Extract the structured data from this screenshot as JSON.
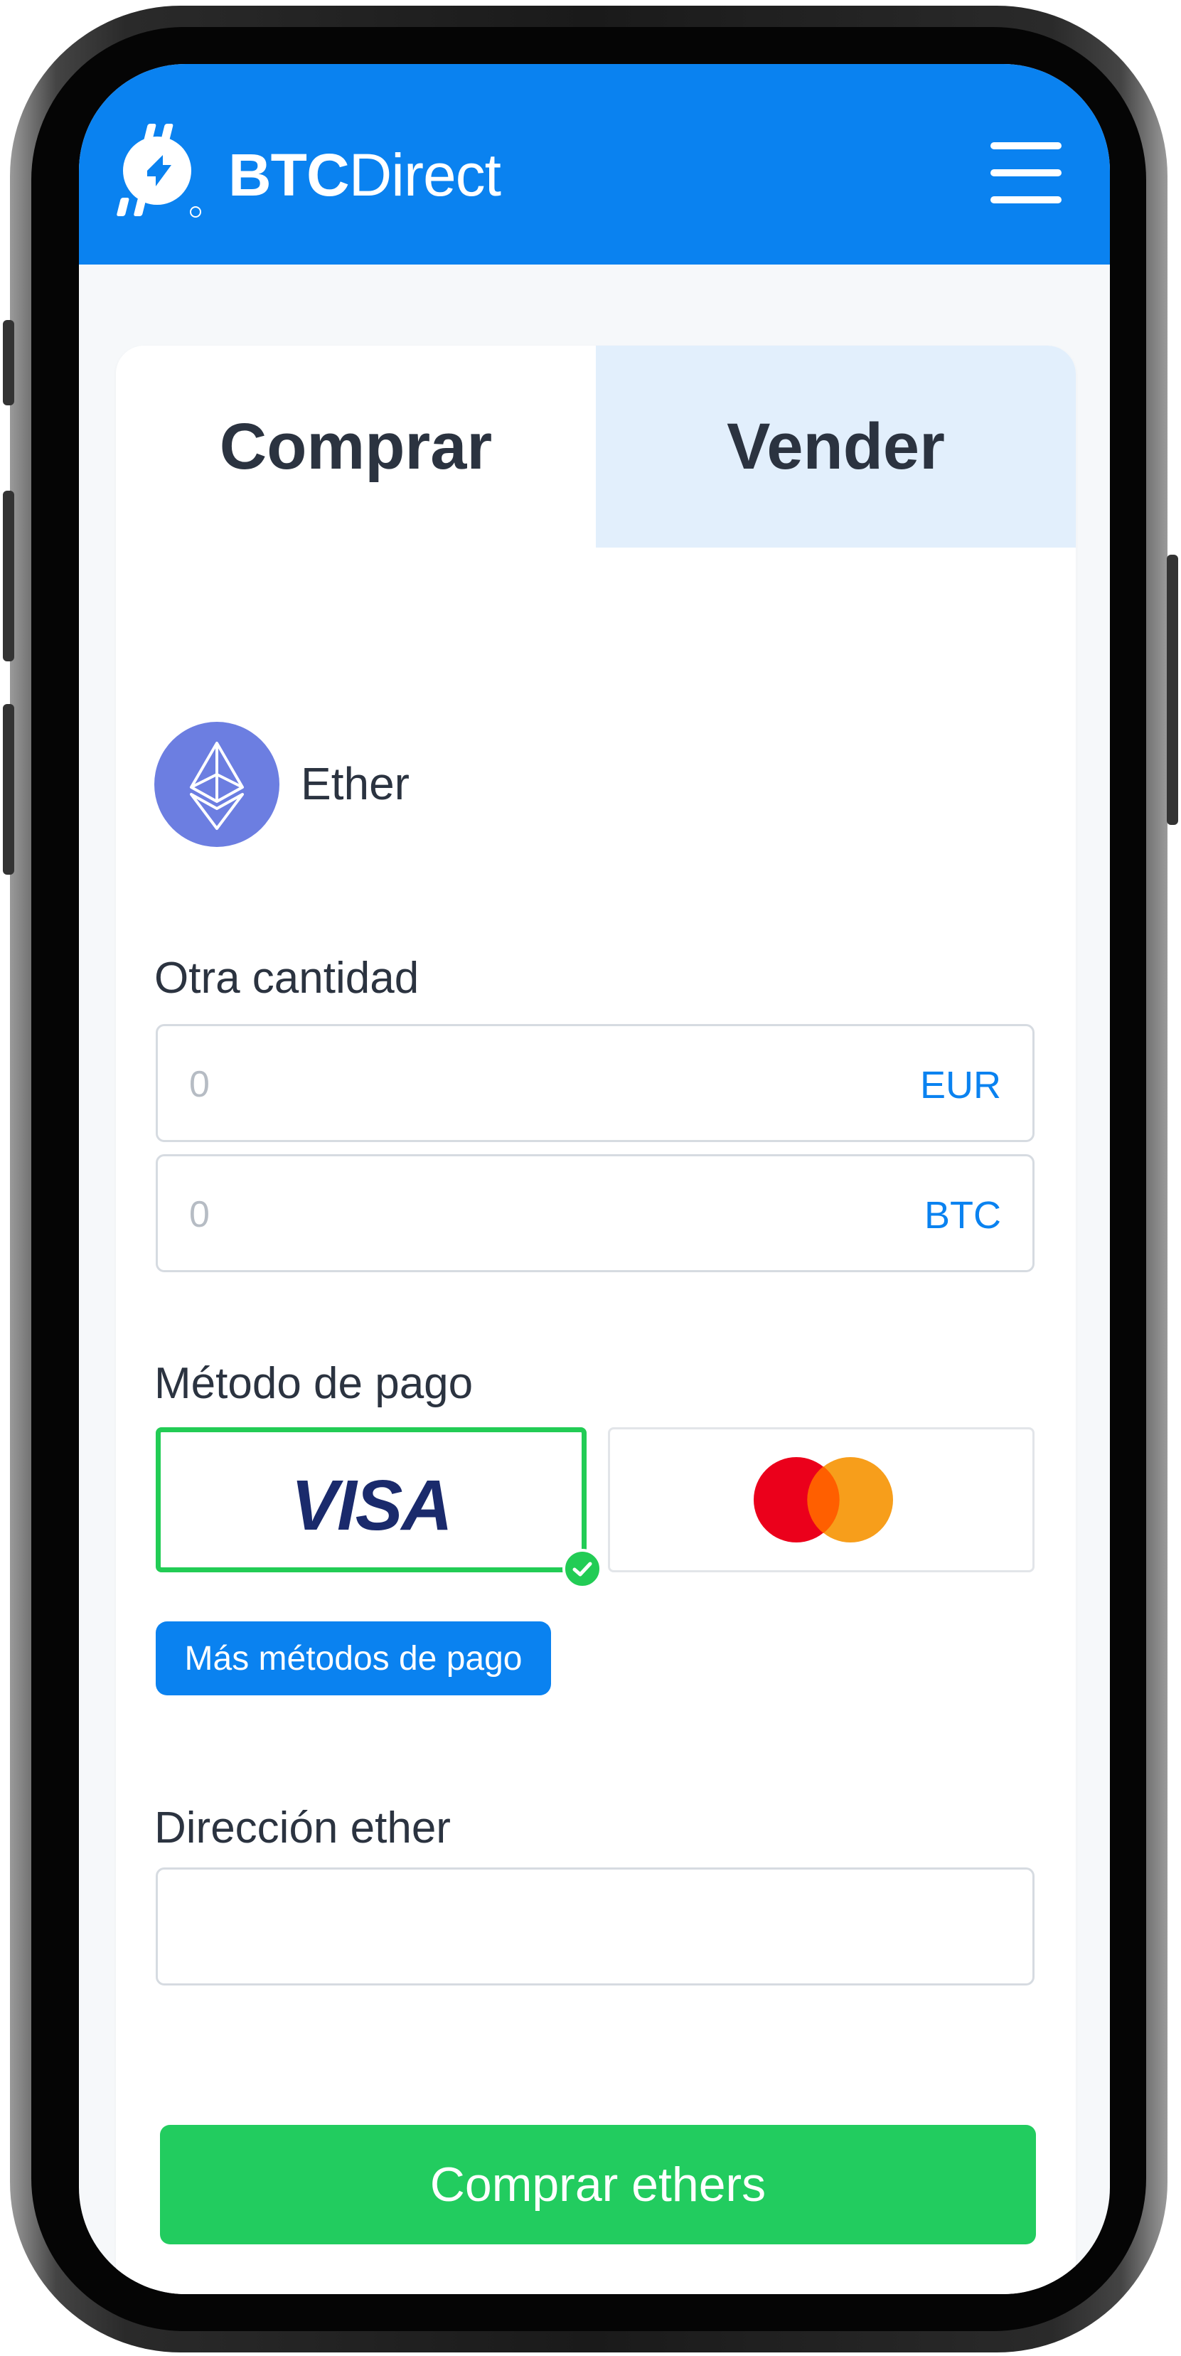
{
  "header": {
    "brand_bold": "BTC",
    "brand_light": "Direct",
    "brand_color": "#0a82f0"
  },
  "tabs": [
    {
      "label": "Comprar",
      "active": true
    },
    {
      "label": "Vender",
      "active": false
    }
  ],
  "coin": {
    "icon": "ethereum-icon",
    "label": "Ether"
  },
  "amount": {
    "label": "Otra cantidad",
    "fiat": {
      "placeholder": "0",
      "unit": "EUR"
    },
    "crypto": {
      "placeholder": "0",
      "unit": "BTC"
    }
  },
  "payment": {
    "label": "Método de pago",
    "methods": [
      {
        "name": "VISA",
        "selected": true
      },
      {
        "name": "mastercard-logo",
        "selected": false
      }
    ],
    "more_label": "Más métodos de pago"
  },
  "address": {
    "label": "Dirección ether",
    "value": ""
  },
  "submit_label": "Comprar ethers",
  "colors": {
    "accent_blue": "#0a82f0",
    "success_green": "#22cc5f",
    "tab_inactive_bg": "#e2effc",
    "eth_purple": "#6c7ee1"
  }
}
